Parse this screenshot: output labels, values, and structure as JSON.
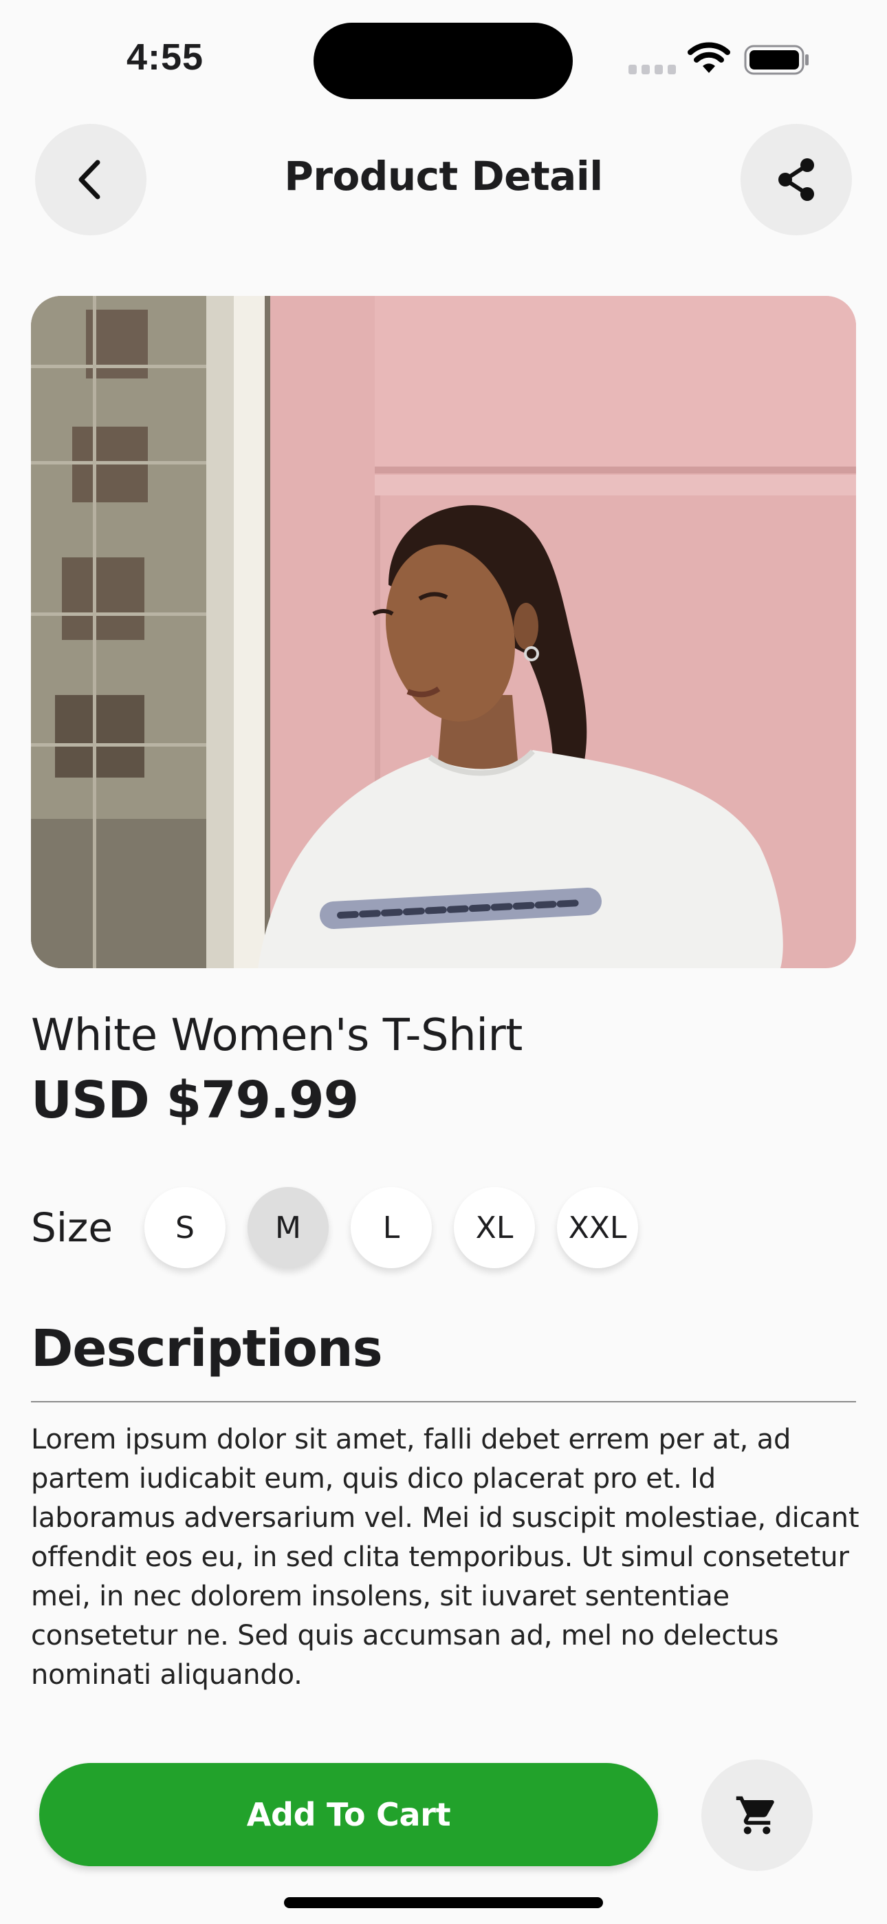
{
  "status_bar": {
    "time": "4:55",
    "icons": [
      "signal-icon",
      "wifi-icon",
      "battery-icon"
    ]
  },
  "header": {
    "title": "Product Detail",
    "back_icon": "chevron-left-icon",
    "share_icon": "share-icon"
  },
  "product": {
    "image": "photo-model-white-tshirt-pink-wall",
    "name": "White Women's T-Shirt",
    "price": "USD $79.99"
  },
  "size": {
    "label": "Size",
    "options": [
      "S",
      "M",
      "L",
      "XL",
      "XXL"
    ],
    "selected": "M"
  },
  "description": {
    "title": "Descriptions",
    "body": "Lorem ipsum dolor sit amet, falli debet errem per at, ad partem iudicabit eum, quis dico placerat pro et. Id laboramus adversarium vel. Mei id suscipit molestiae, dicant offendit eos eu, in sed clita temporibus. Ut simul consetetur mei, in nec dolorem insolens, sit iuvaret sententiae consetetur ne. Sed quis accumsan ad, mel no delectus nominati aliquando."
  },
  "actions": {
    "add_to_cart_label": "Add To Cart",
    "cart_icon": "shopping-cart-icon"
  },
  "colors": {
    "accent": "#22a22b",
    "background": "#fafafa",
    "button_bg": "#ececec",
    "selected_size_bg": "#dedede"
  }
}
